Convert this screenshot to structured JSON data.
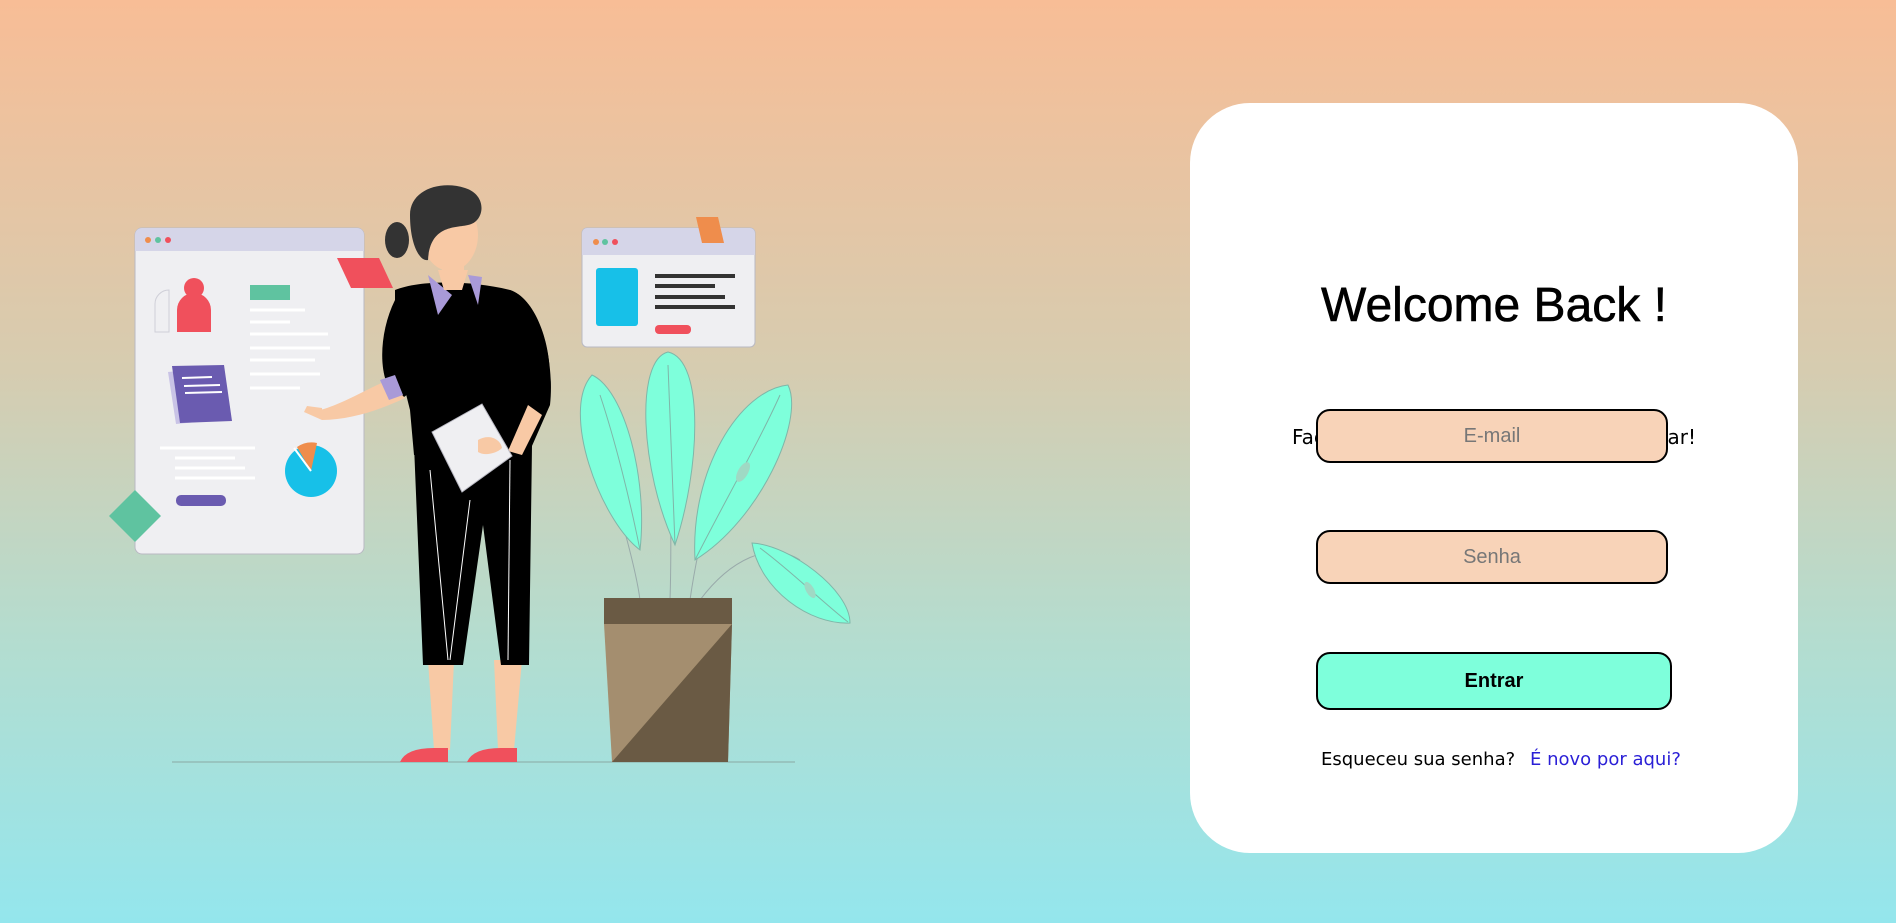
{
  "login": {
    "title": "Welcome Back !",
    "subtitle": "Faça o login em sua conta para acessar!",
    "email_placeholder": "E-mail",
    "password_placeholder": "Senha",
    "submit_label": "Entrar",
    "forgot_label": "Esqueceu sua senha?",
    "signup_label": "É novo por aqui?"
  },
  "colors": {
    "background_top": "#f8bd96",
    "background_bottom": "#94e6ed",
    "card": "#ffffff",
    "input_fill": "#f8d3b8",
    "button_fill": "#7effdb",
    "link": "#2a1fd6"
  },
  "illustration": {
    "subject": "woman-presenting-dashboard-with-plant"
  }
}
